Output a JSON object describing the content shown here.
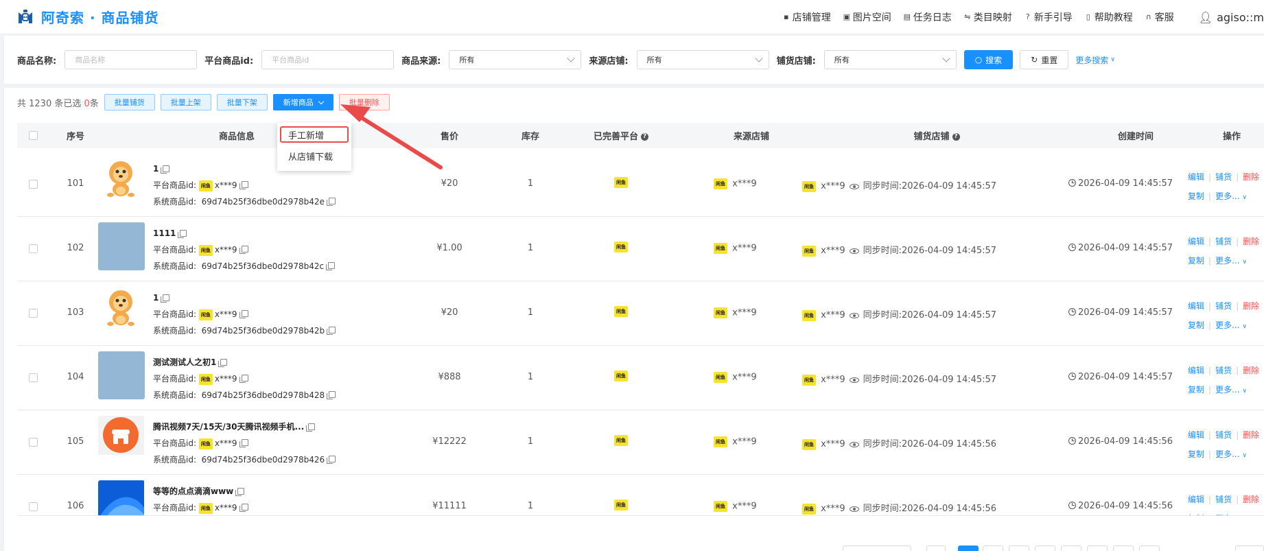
{
  "header": {
    "title": "阿奇索 · 商品铺货",
    "nav": [
      {
        "icon": "store-icon",
        "label": "店铺管理"
      },
      {
        "icon": "image-icon",
        "label": "图片空间"
      },
      {
        "icon": "log-icon",
        "label": "任务日志"
      },
      {
        "icon": "mapping-icon",
        "label": "类目映射"
      },
      {
        "icon": "help-icon",
        "label": "新手引导"
      },
      {
        "icon": "doc-icon",
        "label": "帮助教程"
      },
      {
        "icon": "headset-icon",
        "label": "客服"
      }
    ],
    "user": "agiso::m"
  },
  "search": {
    "name_label": "商品名称:",
    "name_placeholder": "商品名称",
    "pid_label": "平台商品id:",
    "pid_placeholder": "平台商品id",
    "source_label": "商品来源:",
    "source_value": "所有",
    "source_store_label": "来源店铺:",
    "source_store_value": "所有",
    "target_store_label": "铺货店铺:",
    "target_store_value": "所有",
    "search_btn": "搜索",
    "reset_btn": "重置",
    "more_link": "更多搜索"
  },
  "toolbar": {
    "count_prefix": "共 1230 条已选 ",
    "selected": "0",
    "count_suffix": "条",
    "batch_distribute": "批量铺货",
    "batch_up": "批量上架",
    "batch_down": "批量下架",
    "add_product": "新增商品",
    "batch_delete": "批量删除"
  },
  "dropdown": {
    "manual": "手工新增",
    "download": "从店铺下载"
  },
  "table": {
    "headers": {
      "index": "序号",
      "info": "商品信息",
      "price": "售价",
      "stock": "库存",
      "platform": "已完善平台",
      "source_store": "来源店铺",
      "target_store": "铺货店铺",
      "created": "创建时间",
      "ops": "操作"
    },
    "labels": {
      "pid": "平台商品id:",
      "sid": "系统商品id:",
      "sync": "同步时间:",
      "platform_badge": "闲鱼",
      "edit": "编辑",
      "distribute": "铺货",
      "delete": "删除",
      "copy": "复制",
      "more": "更多..."
    },
    "rows": [
      {
        "idx": "101",
        "name": "1",
        "thumb": "lion",
        "pid": "x***9",
        "sid": "69d74b25f36dbe0d2978b42e",
        "price": "¥20",
        "stock": "1",
        "src": "x***9",
        "dst": "x***9",
        "sync": "2026-04-09 14:45:57",
        "created": "2026-04-09 14:45:57"
      },
      {
        "idx": "102",
        "name": "1111",
        "thumb": "blue",
        "pid": "x***9",
        "sid": "69d74b25f36dbe0d2978b42c",
        "price": "¥1.00",
        "stock": "1",
        "src": "x***9",
        "dst": "x***9",
        "sync": "2026-04-09 14:45:57",
        "created": "2026-04-09 14:45:57"
      },
      {
        "idx": "103",
        "name": "1",
        "thumb": "lion",
        "pid": "x***9",
        "sid": "69d74b25f36dbe0d2978b42b",
        "price": "¥20",
        "stock": "1",
        "src": "x***9",
        "dst": "x***9",
        "sync": "2026-04-09 14:45:57",
        "created": "2026-04-09 14:45:57"
      },
      {
        "idx": "104",
        "name": "测试测试人之初1",
        "thumb": "blue",
        "pid": "x***9",
        "sid": "69d74b25f36dbe0d2978b428",
        "price": "¥888",
        "stock": "1",
        "src": "x***9",
        "dst": "x***9",
        "sync": "2026-04-09 14:45:57",
        "created": "2026-04-09 14:45:57"
      },
      {
        "idx": "105",
        "name": "腾讯视频7天/15天/30天腾讯视频手机...",
        "thumb": "orange",
        "pid": "x***9",
        "sid": "69d74b25f36dbe0d2978b426",
        "price": "¥12222",
        "stock": "1",
        "src": "x***9",
        "dst": "x***9",
        "sync": "2026-04-09 14:45:56",
        "created": "2026-04-09 14:45:56"
      },
      {
        "idx": "106",
        "name": "等等的点点滴滴www",
        "thumb": "win",
        "pid": "x***9",
        "sid": "",
        "price": "¥11111",
        "stock": "1",
        "src": "x***9",
        "dst": "x***9",
        "sync": "2026-04-09 14:45:56",
        "created": "2026-04-09 14:45:56"
      }
    ]
  },
  "colors": {
    "primary": "#1890ff",
    "danger": "#ff4d4f",
    "platform_yellow": "#f7e22c",
    "annotation_red": "#e94a4a"
  }
}
